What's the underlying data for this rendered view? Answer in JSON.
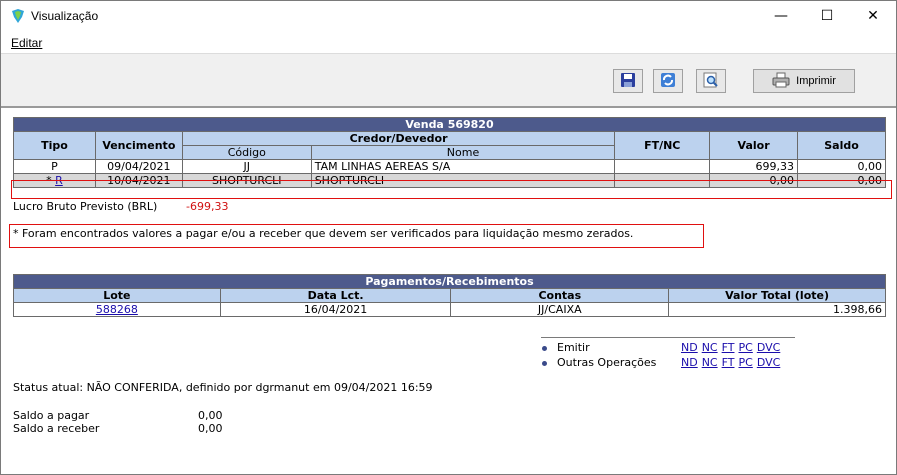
{
  "window": {
    "title": "Visualização",
    "minimize": "—",
    "maximize": "☐",
    "close": "✕"
  },
  "menu": {
    "edit": "Editar"
  },
  "toolbar": {
    "print_label": "Imprimir"
  },
  "sale": {
    "caption": "Venda  569820",
    "headers": {
      "tipo": "Tipo",
      "vencimento": "Vencimento",
      "credor": "Credor/Devedor",
      "codigo": "Código",
      "nome": "Nome",
      "ftnc": "FT/NC",
      "valor": "Valor",
      "saldo": "Saldo"
    },
    "rows": [
      {
        "tipo": "P",
        "vencimento": "09/04/2021",
        "codigo": "JJ",
        "nome": "TAM LINHAS AEREAS S/A",
        "ftnc": "",
        "valor": "699,33",
        "saldo": "0,00"
      },
      {
        "tipo_prefix": "* ",
        "tipo_link": "R",
        "vencimento": "10/04/2021",
        "codigo": "SHOPTURCLI",
        "nome": "SHOPTURCLI",
        "ftnc": "",
        "valor": "0,00",
        "saldo": "0,00"
      }
    ]
  },
  "profit": {
    "label": "Lucro Bruto Previsto (BRL)",
    "value": "-699,33"
  },
  "warning": "* Foram encontrados valores a pagar e/ou a receber que devem ser verificados para liquidação mesmo zerados.",
  "payments": {
    "caption": "Pagamentos/Recebimentos",
    "headers": {
      "lote": "Lote",
      "data": "Data Lct.",
      "contas": "Contas",
      "valor_total": "Valor Total (lote)"
    },
    "rows": [
      {
        "lote": "588268",
        "data": "16/04/2021",
        "contas": "JJ/CAIXA",
        "valor_total": "1.398,66"
      }
    ]
  },
  "operations": {
    "emitir_label": "Emitir",
    "outras_label": "Outras Operações",
    "emitir_links": [
      "ND",
      "NC",
      "FT",
      "PC",
      "DVC"
    ],
    "outras_links": [
      "ND",
      "NC",
      "FT",
      "PC",
      "DVC"
    ]
  },
  "status": "Status atual: NÃO CONFERIDA, definido por dgrmanut em 09/04/2021 16:59",
  "balances": {
    "pagar_label": "Saldo a pagar",
    "pagar_value": "0,00",
    "receber_label": "Saldo a receber",
    "receber_value": "0,00"
  },
  "colors": {
    "caption_bg": "#4d5a8c",
    "header_bg": "#bcd2ee",
    "highlight": "#e01010",
    "negative": "#d01010",
    "link": "#1a0dab"
  }
}
